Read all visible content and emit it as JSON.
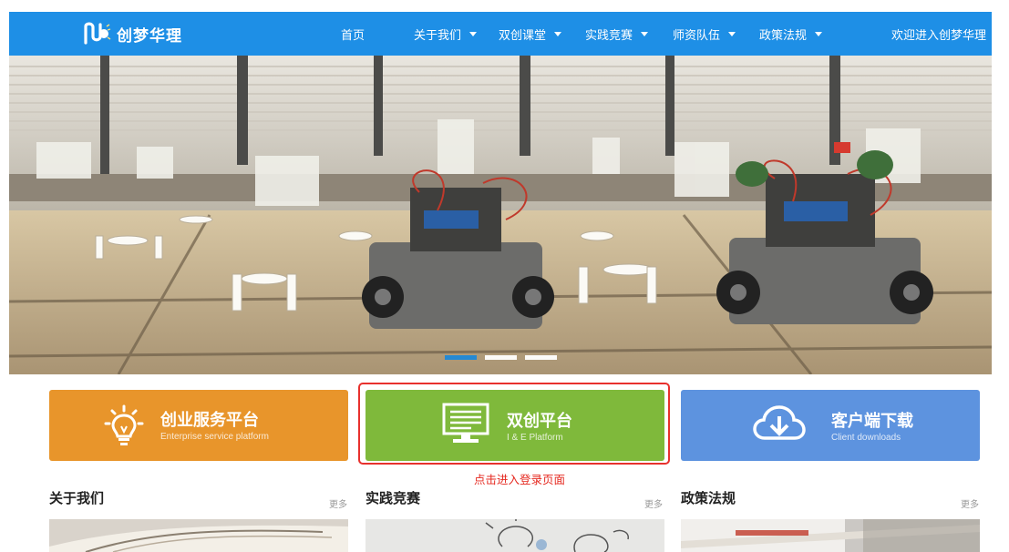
{
  "brand": {
    "name": "创梦华理"
  },
  "nav": {
    "items": [
      {
        "label": "首页",
        "dropdown": false
      },
      {
        "label": "关于我们",
        "dropdown": true
      },
      {
        "label": "双创课堂",
        "dropdown": true
      },
      {
        "label": "实践竞赛",
        "dropdown": true
      },
      {
        "label": "师资队伍",
        "dropdown": true
      },
      {
        "label": "政策法规",
        "dropdown": true
      }
    ],
    "welcome": "欢迎进入创梦华理"
  },
  "carousel": {
    "slide_count": 3,
    "active_index": 0
  },
  "cards": [
    {
      "title": "创业服务平台",
      "subtitle": "Enterprise service platform",
      "icon": "lightbulb-icon",
      "color": "#e8952b"
    },
    {
      "title": "双创平台",
      "subtitle": "I & E Platform",
      "icon": "monitor-icon",
      "color": "#7fb93b"
    },
    {
      "title": "客户端下载",
      "subtitle": "Client downloads",
      "icon": "cloud-download-icon",
      "color": "#5d93df"
    }
  ],
  "annotation": {
    "text": "点击进入登录页面",
    "color": "#e5281f"
  },
  "sections": [
    {
      "title": "关于我们",
      "more": "更多"
    },
    {
      "title": "实践竞赛",
      "more": "更多"
    },
    {
      "title": "政策法规",
      "more": "更多"
    }
  ],
  "theme": {
    "primary": "#1e8fe6"
  }
}
